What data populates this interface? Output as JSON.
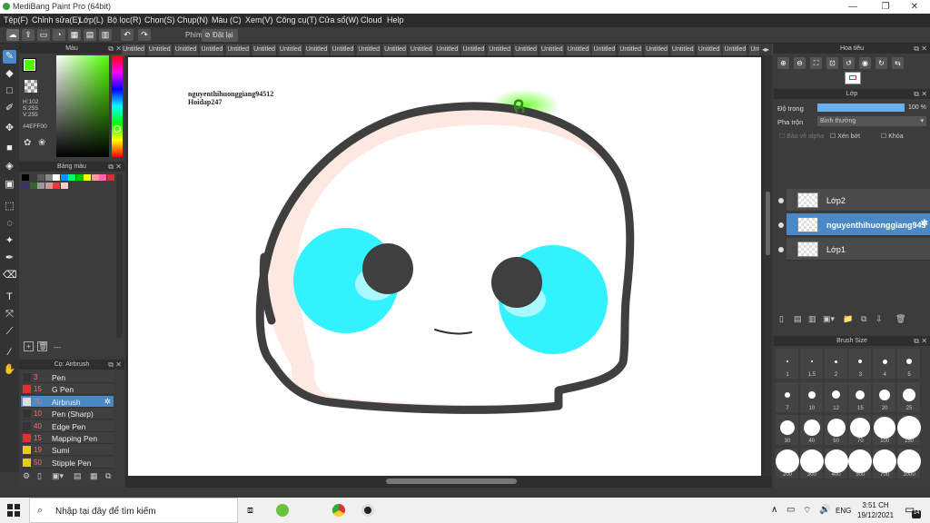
{
  "window": {
    "title": "MediBang Paint Pro (64bit)"
  },
  "menu": [
    "Tệp(F)",
    "Chỉnh sửa(E)",
    "Lớp(L)",
    "Bộ lọc(R)",
    "Chọn(S)",
    "Chụp(N)",
    "Màu (C)",
    "Xem(V)",
    "Công cụ(T)",
    "Cửa sổ(W)",
    "Cloud",
    "Help"
  ],
  "toolbar": {
    "key_label": "Phím",
    "reset_label": "Đặt lại"
  },
  "color_panel": {
    "title": "Màu",
    "hsv": [
      "H:102",
      "S:255",
      "V:255"
    ],
    "hex": "#4EFF00",
    "foreground_color": "#4eff00"
  },
  "palette_panel": {
    "title": "Bảng màu",
    "colors": [
      "#000000",
      "#3a3a3a",
      "#5a5a5a",
      "#888",
      "#ffffff",
      "#0099ff",
      "#00ff66",
      "#00cc00",
      "#ffff00",
      "#ff9999",
      "#ff66aa",
      "#cc3333",
      "#333366",
      "#336633",
      "#999999",
      "#cc9999",
      "#ff3333",
      "#ffcccc"
    ],
    "footer": "---"
  },
  "brush_panel": {
    "title": "Cọ: Airbrush",
    "items": [
      {
        "size": "3",
        "name": "Pen",
        "color": "#333333"
      },
      {
        "size": "15",
        "name": "G Pen",
        "color": "#e03030"
      },
      {
        "size": "70",
        "name": "Airbrush",
        "color": "#dddddd"
      },
      {
        "size": "10",
        "name": "Pen (Sharp)",
        "color": "#333333"
      },
      {
        "size": "40",
        "name": "Edge Pen",
        "color": "#333333"
      },
      {
        "size": "15",
        "name": "Mapping Pen",
        "color": "#e03030"
      },
      {
        "size": "19",
        "name": "Sumi",
        "color": "#e8d000"
      },
      {
        "size": "50",
        "name": "Stipple Pen",
        "color": "#e8d000"
      }
    ]
  },
  "tabs": [
    "Untitled",
    "Untitled",
    "Untitled",
    "Untitled",
    "Untitled",
    "Untitled",
    "Untitled",
    "Untitled",
    "Untitled",
    "Untitled",
    "Untitled",
    "Untitled",
    "Untitled",
    "Untitled",
    "Untitled",
    "Untitled",
    "Untitled",
    "Untitled",
    "Untitled",
    "Untitled",
    "Untitled",
    "Untitled",
    "Untitled",
    "Untitled",
    "Untitled",
    "Untitled"
  ],
  "canvas": {
    "watermark_line1": "nguyenthihuonggiang94512",
    "watermark_line2": "Hoidap247"
  },
  "navigator": {
    "title": "Hoa tiêu"
  },
  "layer_panel": {
    "title": "Lớp",
    "opacity_label": "Độ trong",
    "opacity_value": "100 %",
    "opacity": 1.0,
    "blend_label": "Pha trộn",
    "blend_value": "Bình thường",
    "protect_alpha": "Bảo vệ alpha",
    "clip": "Xén bớt",
    "lock": "Khóa",
    "layers": [
      {
        "name": "Lớp2"
      },
      {
        "name": "nguyenthihuonggiang94512"
      },
      {
        "name": "Lớp1"
      }
    ]
  },
  "brush_size": {
    "title": "Brush Size",
    "sizes": [
      "1",
      "1.5",
      "2",
      "3",
      "4",
      "5",
      "7",
      "10",
      "12",
      "15",
      "20",
      "25",
      "30",
      "40",
      "50",
      "70",
      "100",
      "150",
      "200",
      "300",
      "400",
      "500",
      "700",
      "1000"
    ]
  },
  "taskbar": {
    "search_placeholder": "Nhập tại đây để tìm kiếm",
    "lang": "ENG",
    "time": "3:51 CH",
    "date": "19/12/2021",
    "notif": "14"
  }
}
